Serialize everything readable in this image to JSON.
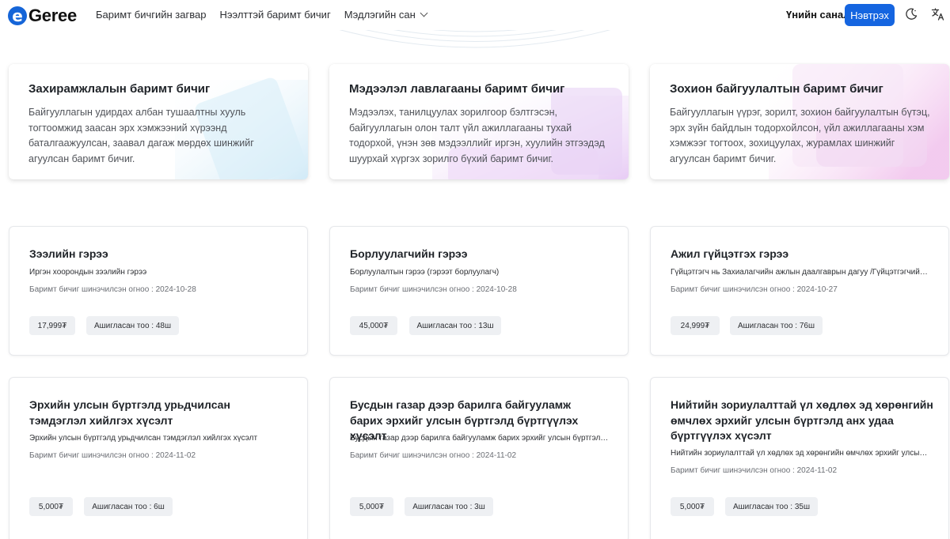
{
  "brand": {
    "logo_letter": "e",
    "name": "Geree",
    "accent": "#1565e0"
  },
  "nav": [
    {
      "label": "Баримт бичгийн загвар"
    },
    {
      "label": "Нээлттэй баримт бичиг"
    },
    {
      "label": "Мэдлэгийн сан",
      "has_dropdown": true
    }
  ],
  "header": {
    "feedback_label": "Үнийн санал",
    "login_label": "Нэвтрэх",
    "theme_icon": "moon-icon",
    "lang_icon": "translate-icon"
  },
  "categories": [
    {
      "title": "Захирамжлалын баримт бичиг",
      "description": "Байгууллагын удирдах албан тушаалтны хууль тогтоомжид заасан эрх хэмжээний хүрээнд баталгаажуулсан, заавал дагаж мөрдөх шинжийг агуулсан баримт бичиг."
    },
    {
      "title": "Мэдээлэл лавлагааны баримт бичиг",
      "description": "Мэдээлэх, танилцуулах зорилгоор бэлтгэсэн, байгууллагын олон талт үйл ажиллагааны тухай тодорхой, үнэн зөв мэдээллийг иргэн, хуулийн этгээдэд шуурхай хүргэх зорилго бүхий баримт бичиг."
    },
    {
      "title": "Зохион байгуулалтын баримт бичиг",
      "description": "Байгууллагын үүрэг, зорилт, зохион байгуулалтын бүтэц, эрх зүйн байдлын тодорхойлсон, үйл ажиллагааны хэм хэмжээг тогтоох, зохицуулах, журамлах шинжийг агуулсан баримт бичиг."
    }
  ],
  "documents": [
    {
      "title": "Зээлийн гэрээ",
      "subtitle": "Иргэн хоорондын зээлийн гэрээ",
      "date": "Баримт бичиг шинэчилсэн огноо : 2024-10-28",
      "price": "17,999₮",
      "usage": "Ашигласан тоо : 48ш"
    },
    {
      "title": "Борлуулагчийн гэрээ",
      "subtitle": "Борлуулалтын гэрээ (гэрээт борлуулагч)",
      "date": "Баримт бичиг шинэчилсэн огноо : 2024-10-28",
      "price": "45,000₮",
      "usage": "Ашигласан тоо : 13ш"
    },
    {
      "title": "Ажил гүйцэтгэх гэрээ",
      "subtitle": "Гүйцэтгэгч нь Захиалагчийн ажлын даалгаврын дагуу /Гүйцэтгэгчийн хөрөнгөөр/ ажил гүйцэтгэх",
      "date": "Баримт бичиг шинэчилсэн огноо : 2024-10-27",
      "price": "24,999₮",
      "usage": "Ашигласан тоо : 76ш"
    },
    {
      "title": "Эрхийн улсын бүртгэлд урьдчилсан тэмдэглэл хийлгэх хүсэлт",
      "subtitle": "Эрхийн улсын бүртгэлд урьдчилсан тэмдэглэл хийлгэх хүсэлт",
      "date": "Баримт бичиг шинэчилсэн огноо : 2024-11-02",
      "price": "5,000₮",
      "usage": "Ашигласан тоо : 6ш"
    },
    {
      "title": "Бусдын газар дээр барилга байгууламж барих эрхийг улсын бүртгэлд бүртгүүлэх хүсэлт",
      "subtitle": "Бусдын газар дээр барилга байгууламж барих эрхийг улсын бүртгэлд бүртгүүлэх хүсэлт",
      "date": "Баримт бичиг шинэчилсэн огноо : 2024-11-02",
      "price": "5,000₮",
      "usage": "Ашигласан тоо : 3ш"
    },
    {
      "title": "Нийтийн зориулалттай үл хөдлөх эд хөрөнгийн өмчлөх эрхийг улсын бүртгэлд анх удаа бүртгүүлэх хүсэлт",
      "subtitle": "Нийтийн зориулалттай үл хөдлөх эд хөрөнгийн өмчлөх эрхийг улсын бүртгэлд анх удаа бүртгүүлэх хүсэлт",
      "date": "Баримт бичиг шинэчилсэн огноо : 2024-11-02",
      "price": "5,000₮",
      "usage": "Ашигласан тоо : 35ш"
    }
  ]
}
